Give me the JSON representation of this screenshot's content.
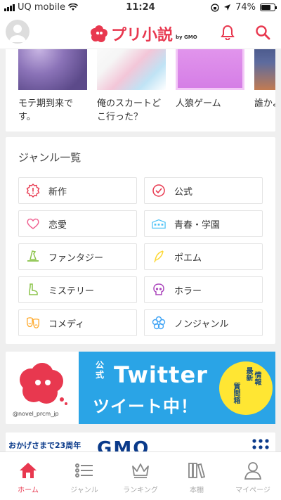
{
  "status_bar": {
    "carrier": "UQ mobile",
    "time": "11:24",
    "battery": "74%",
    "battery_level": 0.74
  },
  "header": {
    "logo_text": "プリ小説",
    "logo_by": "by GMO",
    "icons": [
      "bell-icon",
      "search-icon"
    ]
  },
  "novels": [
    {
      "title": "モテ期到来です。"
    },
    {
      "title": "俺のスカートどこ行った？"
    },
    {
      "title": "人狼ゲーム"
    },
    {
      "title": "誰かよ！"
    }
  ],
  "genre": {
    "heading": "ジャンル一覧",
    "items": [
      {
        "label": "新作",
        "icon": "new-badge-icon",
        "color": "#e8384f"
      },
      {
        "label": "公式",
        "icon": "check-circle-icon",
        "color": "#e8384f"
      },
      {
        "label": "恋愛",
        "icon": "heart-icon",
        "color": "#f06292"
      },
      {
        "label": "青春・学園",
        "icon": "school-icon",
        "color": "#4fc3f7"
      },
      {
        "label": "ファンタジー",
        "icon": "witch-hat-icon",
        "color": "#8bc34a"
      },
      {
        "label": "ポエム",
        "icon": "feather-icon",
        "color": "#fdd835"
      },
      {
        "label": "ミステリー",
        "icon": "boot-icon",
        "color": "#8bc34a"
      },
      {
        "label": "ホラー",
        "icon": "skull-icon",
        "color": "#ab47bc"
      },
      {
        "label": "コメディ",
        "icon": "mask-icon",
        "color": "#ffa726"
      },
      {
        "label": "ノンジャンル",
        "icon": "flower-icon",
        "color": "#42a5f5"
      }
    ]
  },
  "banner": {
    "handle": "@novel_prcm_jp",
    "official": "公式",
    "title": "Twitter",
    "subtitle": "ツイート中！",
    "badge": [
      "最新",
      "情報",
      "質問箱"
    ]
  },
  "gmo_banner": {
    "text": "おかげさまで23周年",
    "logo": "GMO"
  },
  "tabbar": {
    "tabs": [
      {
        "label": "ホーム",
        "icon": "home-icon",
        "active": true
      },
      {
        "label": "ジャンル",
        "icon": "list-icon",
        "active": false
      },
      {
        "label": "ランキング",
        "icon": "crown-icon",
        "active": false
      },
      {
        "label": "本棚",
        "icon": "bookshelf-icon",
        "active": false
      },
      {
        "label": "マイページ",
        "icon": "person-icon",
        "active": false
      }
    ]
  },
  "colors": {
    "accent": "#e8384f",
    "twitter_blue": "#2aa4e6",
    "badge_yellow": "#ffe633"
  }
}
